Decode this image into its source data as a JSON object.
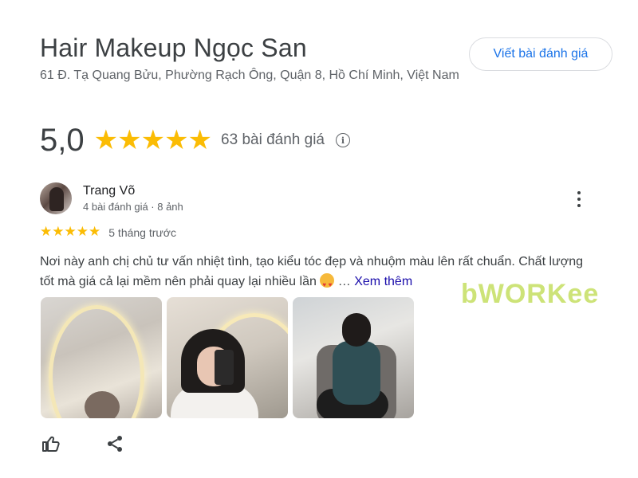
{
  "place": {
    "title": "Hair Makeup Ngọc San",
    "address": "61 Đ. Tạ Quang Bửu, Phường Rạch Ông, Quận 8, Hồ Chí Minh, Việt Nam",
    "write_review_label": "Viết bài đánh giá"
  },
  "rating": {
    "score": "5,0",
    "stars": 5,
    "review_count": "63 bài đánh giá",
    "info_icon": "info-icon"
  },
  "review": {
    "reviewer_name": "Trang Võ",
    "reviewer_meta": "4 bài đánh giá · 8 ảnh",
    "stars": 5,
    "time_ago": "5 tháng trước",
    "text": "Nơi này anh chị chủ tư vấn nhiệt tình, tạo kiểu tóc đẹp và nhuộm màu lên rất chuẩn. Chất lượng tốt mà giá cả lại mềm nên phải quay lại nhiều lần",
    "ellipsis": "…",
    "more_label": "Xem thêm",
    "photo_count_shown": 3
  },
  "watermark": "bWORKee",
  "actions": [
    "like-icon",
    "share-icon"
  ],
  "colors": {
    "star": "#fbbc04",
    "link": "#1a73e8",
    "more_link": "#1a0dab",
    "watermark": "#c8e06a"
  }
}
